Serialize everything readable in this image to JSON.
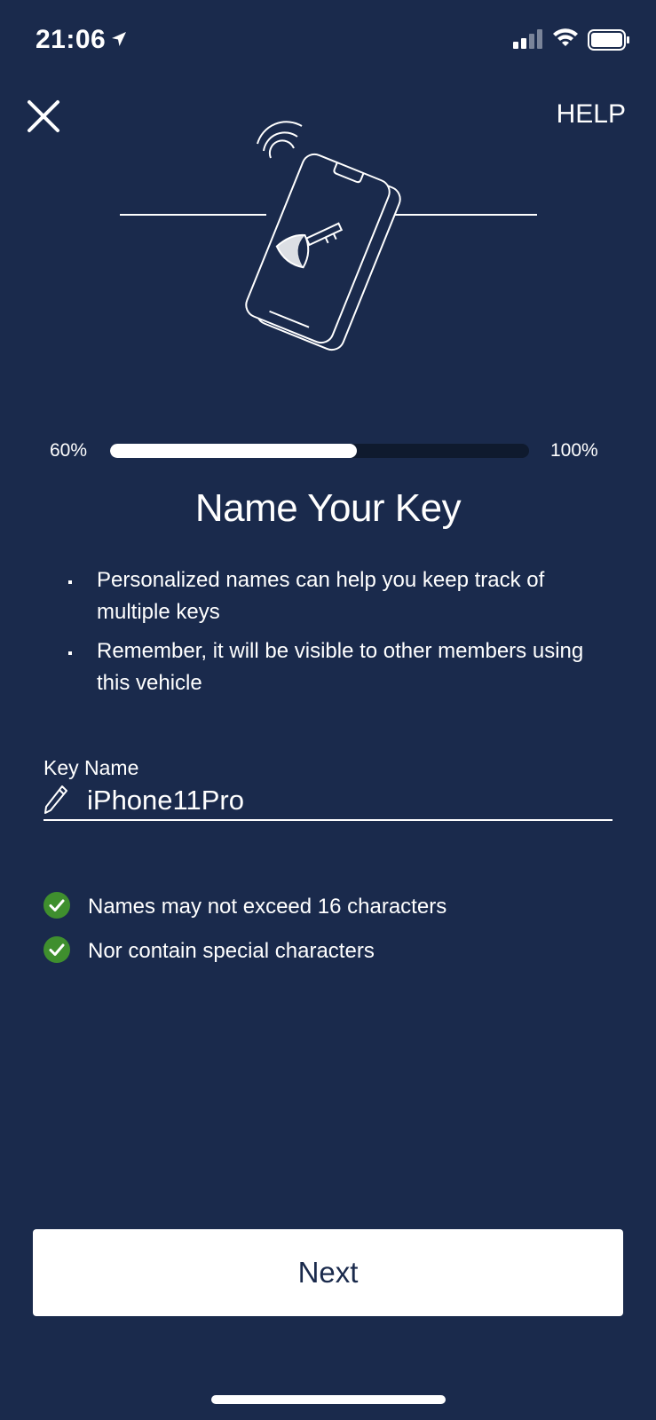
{
  "status_bar": {
    "time": "21:06",
    "icons": [
      "location-arrow-icon",
      "cellular-signal-icon",
      "wifi-icon",
      "battery-icon"
    ]
  },
  "header": {
    "close_icon": "close-icon",
    "help_label": "HELP"
  },
  "illustration": {
    "icon": "phone-key-illustration"
  },
  "progress": {
    "start_label": "60%",
    "end_label": "100%",
    "fill_fraction": 0.59
  },
  "main": {
    "title": "Name Your Key",
    "bullets": [
      "Personalized names can help you keep track of multiple keys",
      "Remember, it will be visible to other members using this vehicle"
    ]
  },
  "field": {
    "label": "Key Name",
    "value": "iPhone11Pro",
    "icon": "pencil-icon"
  },
  "rules": [
    "Names may not exceed 16 characters",
    "Nor contain special characters"
  ],
  "footer": {
    "next_label": "Next"
  },
  "colors": {
    "background": "#1a2a4c",
    "check_green": "#3f8f2e",
    "progress_track": "#0f1a2e"
  }
}
